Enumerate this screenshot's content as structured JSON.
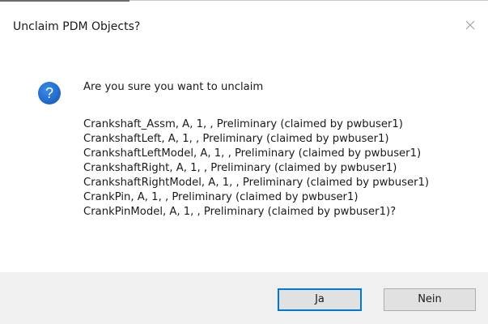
{
  "dialog": {
    "title": "Unclaim PDM Objects?",
    "close_icon": "close-icon",
    "question_icon": "question-icon",
    "accent_color": "#1e6fd9",
    "lead_text": "Are you sure you want to unclaim",
    "items": [
      "Crankshaft_Assm, A, 1, , Preliminary (claimed by pwbuser1)",
      "CrankshaftLeft, A, 1, , Preliminary (claimed by pwbuser1)",
      "CrankshaftLeftModel, A, 1, , Preliminary (claimed by pwbuser1)",
      "CrankshaftRight, A, 1, , Preliminary (claimed by pwbuser1)",
      "CrankshaftRightModel, A, 1, , Preliminary (claimed by pwbuser1)",
      "CrankPin, A, 1, , Preliminary (claimed by pwbuser1)",
      "CrankPinModel, A, 1, , Preliminary (claimed by pwbuser1)?"
    ],
    "buttons": {
      "yes_label": "Ja",
      "no_label": "Nein"
    }
  }
}
